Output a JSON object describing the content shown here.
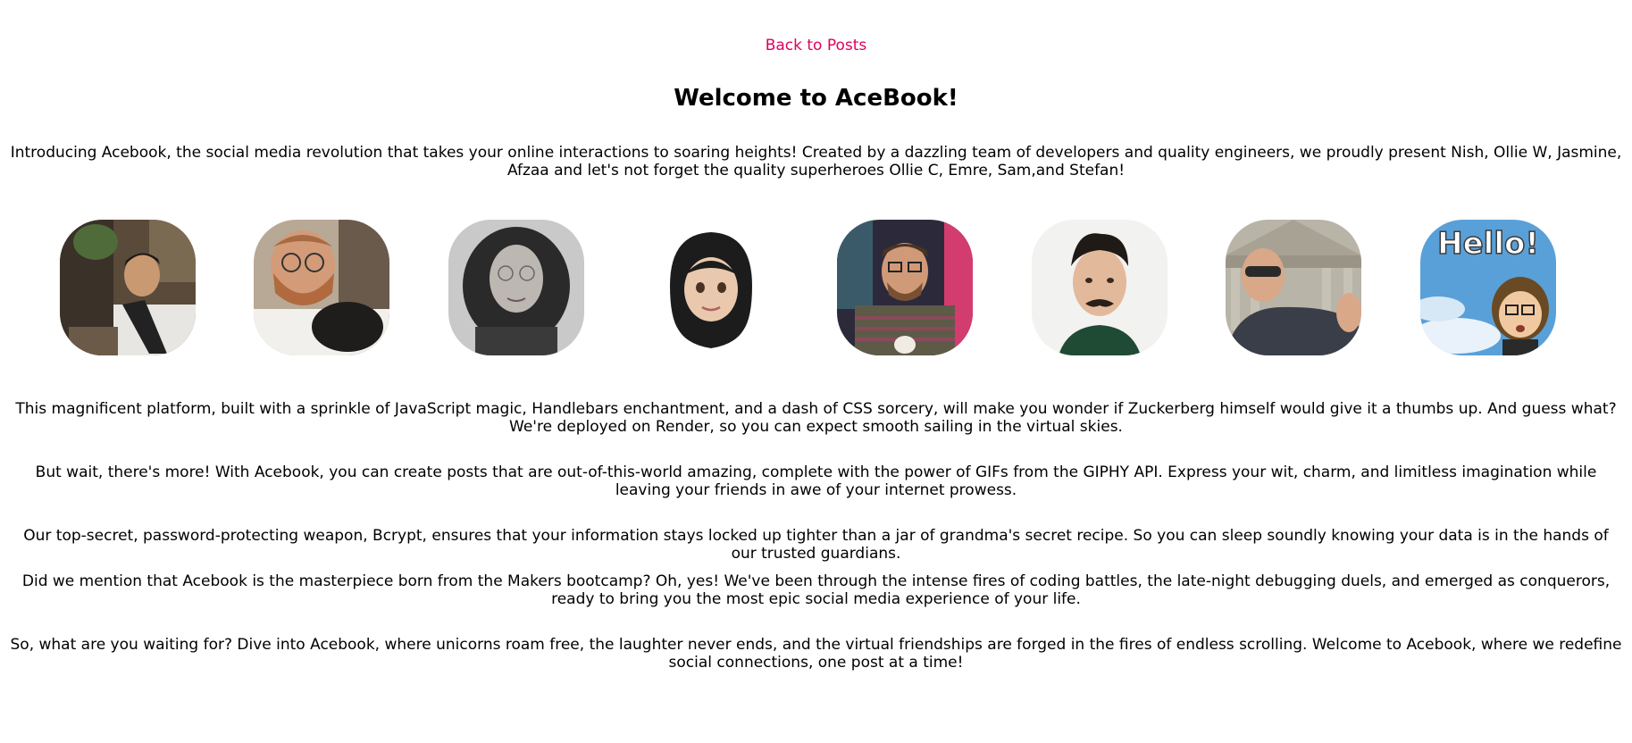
{
  "nav": {
    "back_label": "Back to Posts"
  },
  "page": {
    "title": "Welcome to AceBook!",
    "intro": "Introducing Acebook, the social media revolution that takes your online interactions to soaring heights! Created by a dazzling team of developers and quality engineers, we proudly present Nish, Ollie W, Jasmine, Afzaa and let's not forget the quality superheroes Ollie C, Emre, Sam,and Stefan!",
    "paragraphs": [
      "This magnificent platform, built with a sprinkle of JavaScript magic, Handlebars enchantment, and a dash of CSS sorcery, will make you wonder if Zuckerberg himself would give it a thumbs up. And guess what? We're deployed on Render, so you can expect smooth sailing in the virtual skies.",
      "But wait, there's more! With Acebook, you can create posts that are out-of-this-world amazing, complete with the power of GIFs from the GIPHY API. Express your wit, charm, and limitless imagination while leaving your friends in awe of your internet prowess.",
      "Our top-secret, password-protecting weapon, Bcrypt, ensures that your information stays locked up tighter than a jar of grandma's secret recipe. So you can sleep soundly knowing your data is in the hands of our trusted guardians.",
      "Did we mention that Acebook is the masterpiece born from the Makers bootcamp? Oh, yes! We've been through the intense fires of coding battles, the late-night debugging duels, and emerged as conquerors, ready to bring you the most epic social media experience of your life.",
      "So, what are you waiting for? Dive into Acebook, where unicorns roam free, the laughter never ends, and the virtual friendships are forged in the fires of endless scrolling. Welcome to Acebook, where we redefine social connections, one post at a time!"
    ]
  },
  "team_avatars": {
    "hello_sign_text": "Hello!"
  },
  "colors": {
    "link": "#e0005e",
    "text": "#000000",
    "background": "#ffffff"
  }
}
